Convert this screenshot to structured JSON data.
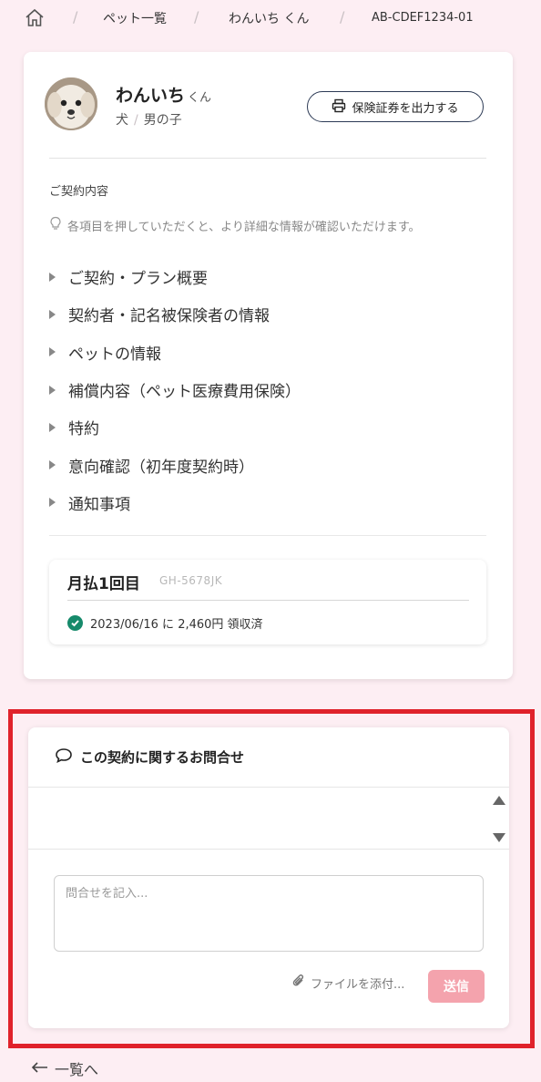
{
  "breadcrumb": {
    "home_icon": "home-icon",
    "items": [
      "ペット一覧",
      "わんいち くん",
      "AB-CDEF1234-01"
    ]
  },
  "pet": {
    "name": "わんいち",
    "suffix": "くん",
    "species": "犬",
    "gender": "男の子"
  },
  "actions": {
    "certificate_label": "保険証券を出力する",
    "certificate_icon": "printer-icon"
  },
  "contract": {
    "section_title": "ご契約内容",
    "hint": "各項目を押していただくと、より詳細な情報が確認いただけます。",
    "hint_icon": "lightbulb-icon",
    "items": [
      "ご契約・プラン概要",
      "契約者・記名被保険者の情報",
      "ペットの情報",
      "補償内容（ペット医療費用保険）",
      "特約",
      "意向確認（初年度契約時）",
      "通知事項"
    ]
  },
  "payment": {
    "title": "月払1回目",
    "code": "GH-5678JK",
    "status": "2023/06/16 に 2,460円 領収済",
    "status_icon": "check-circle-icon",
    "status_color": "#168a6b"
  },
  "inquiry": {
    "title": "この契約に関するお問合せ",
    "title_icon": "chat-bubble-icon",
    "placeholder": "問合せを記入...",
    "attach_label": "ファイルを添付...",
    "attach_icon": "paperclip-icon",
    "send_label": "送信",
    "send_color": "#f4a3ad",
    "highlight_color": "#e0222b"
  },
  "footer": {
    "back_label": "一覧へ",
    "back_icon": "arrow-left-icon"
  }
}
